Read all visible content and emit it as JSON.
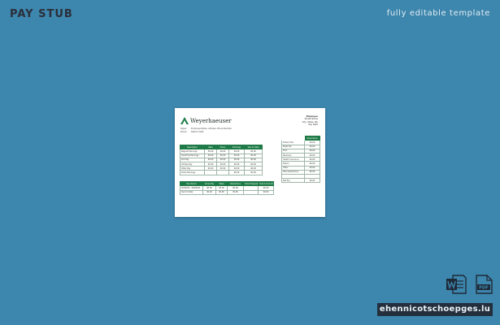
{
  "header": {
    "title": "PAY STUB",
    "tagline": "fully editable template"
  },
  "document": {
    "company": "Weyerhaeuser",
    "employee_block": [
      "Employee",
      "Street Name",
      "City, State, Zip",
      "Pay Date"
    ],
    "meta": [
      {
        "key": "Payee",
        "value": "Employee Name, Address, Phone Number"
      },
      {
        "key": "Period",
        "value": "Date to Date"
      }
    ],
    "earnings": {
      "headers": [
        "Description",
        "Rate",
        "Hours",
        "Earnings",
        "Year to Date"
      ],
      "rows": [
        [
          "Regular Earnings",
          "00.00",
          "00.00",
          "00.00",
          "00.00"
        ],
        [
          "Overtime Earnings",
          "00.00",
          "00.00",
          "00.00",
          "00.00"
        ],
        [
          "Sick Pay",
          "00.00",
          "00.00",
          "00.00",
          "00.00"
        ],
        [
          "Holiday Pay",
          "00.00",
          "00.00",
          "00.00",
          "00.00"
        ],
        [
          "Other Pay",
          "00.00",
          "00.00",
          "00.00",
          "00.00"
        ],
        [
          "Gross Earnings",
          "",
          "",
          "00.00",
          "00.00"
        ]
      ]
    },
    "deductions": {
      "headers": [
        "",
        "Deductions"
      ],
      "rows": [
        [
          "Federal Tax",
          "00.00"
        ],
        [
          "State Tax",
          "00.00"
        ],
        [
          "FICA",
          "00.00"
        ],
        [
          "Medicare",
          "00.00"
        ],
        [
          "Health Insurance",
          "00.00"
        ],
        [
          "401(k)",
          "00.00"
        ],
        [
          "Other",
          "00.00"
        ],
        [
          "Total Deductions",
          "00.00"
        ],
        [
          "",
          ""
        ],
        [
          "Net Pay",
          "00.00"
        ]
      ]
    },
    "payment": {
      "headers": [
        "Pay Period",
        "Gross Pay",
        "Taxes",
        "Deductions",
        "Direct Deposit",
        "Check Amount"
      ],
      "rows": [
        [
          "00/00/00 - 00/00/00",
          "00.00",
          "00.00",
          "00.00",
          "",
          "00.00"
        ],
        [
          "Year to Date",
          "00.00",
          "00.00",
          "00.00",
          "",
          "00.00"
        ]
      ]
    }
  },
  "footer": {
    "site": "ehennicotschoepges.lu"
  },
  "icons": {
    "word": "word-document-icon",
    "pdf": "pdf-document-icon"
  },
  "colors": {
    "background": "#3d86ad",
    "table_header": "#1e7a46",
    "site_banner": "#232f3d"
  }
}
